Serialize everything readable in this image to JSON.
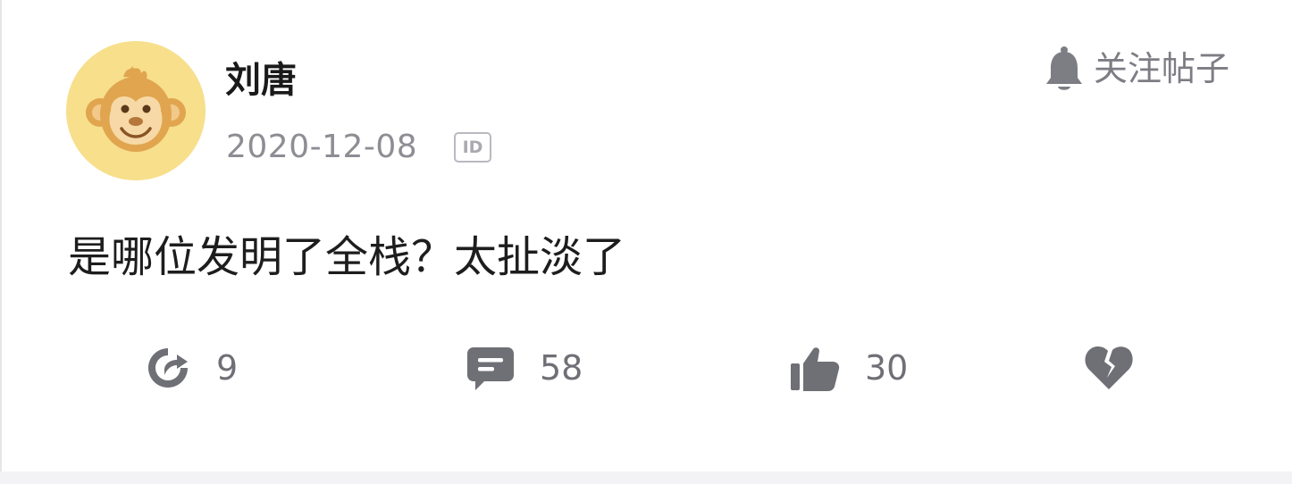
{
  "post": {
    "author_name": "刘唐",
    "date": "2020-12-08",
    "id_badge": "ID",
    "follow_label": "关注帖子",
    "content": "是哪位发明了全栈？太扯淡了",
    "avatar_icon": "monkey-avatar",
    "actions": {
      "share": {
        "icon": "share-arrow-icon",
        "count": "9"
      },
      "comment": {
        "icon": "comment-bubble-icon",
        "count": "58"
      },
      "like": {
        "icon": "thumbs-up-icon",
        "count": "30"
      },
      "dislike": {
        "icon": "broken-heart-icon"
      }
    }
  },
  "colors": {
    "text_primary": "#1a1a1a",
    "text_secondary": "#8d8d94",
    "icon_gray": "#6f6f76",
    "avatar_bg": "#f7df8c",
    "avatar_accent": "#e0a54e"
  }
}
